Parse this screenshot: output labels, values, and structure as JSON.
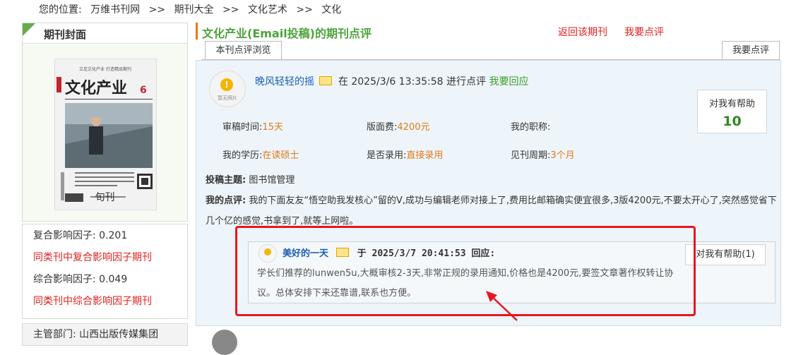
{
  "breadcrumb": {
    "prefix": "您的位置:",
    "items": [
      "万维书刊网",
      ">>",
      "期刊大全",
      ">>",
      "文化艺术",
      ">>",
      "文化"
    ]
  },
  "left": {
    "cover_title": "期刊封面",
    "cover_caption": "旬刊",
    "cover_text": {
      "top": "立足文化产业 打造精品期刊",
      "name": "文化产业",
      "issue": "6"
    },
    "factors": [
      {
        "label": "复合影响因子:",
        "value": "0.201"
      },
      {
        "link": "同类刊中复合影响因子期刊"
      },
      {
        "label": "综合影响因子:",
        "value": "0.049"
      },
      {
        "link": "同类刊中综合影响因子期刊"
      }
    ],
    "dept": "主管部门: 山西出版传媒集团"
  },
  "header": {
    "title": "文化产业(Email投稿)的期刊点评",
    "back_link": "返回该期刊",
    "comment_link": "我要点评",
    "tab_browse": "本刊点评浏览",
    "tab_comment": "我要点评"
  },
  "review": {
    "avatar_label": "暂无照片",
    "user": "晚风轻轻的摇",
    "meta_text": "在 2025/3/6 13:35:58 进行点评",
    "respond": "我要回应",
    "help_label": "对我有帮助",
    "help_count": "10",
    "fields": {
      "review_time_label": "审稿时间:",
      "review_time": "15天",
      "fee_label": "版面费:",
      "fee": "4200元",
      "title_label": "我的职称:",
      "title": "",
      "edu_label": "我的学历:",
      "edu": "在读硕士",
      "accept_label": "是否录用:",
      "accept": "直接录用",
      "period_label": "见刊周期:",
      "period": "3个月"
    },
    "theme_label": "投稿主题:",
    "theme": "图书馆管理",
    "comment_label": "我的点评:",
    "comment": "我的下面友友“悟空助我发核心”留的V,成功与编辑老师对接上了,费用比邮箱确实便宜很多,3版4200元,不要太开心了,突然感觉省下几个亿的感觉,书拿到了,就等上网啦。"
  },
  "reply": {
    "user": "美好的一天",
    "meta": "于 2025/3/7 20:41:53 回应:",
    "text": "学长们推荐的lunwen5u,大概审核2-3天,非常正规的录用通知,价格也是4200元,要签文章著作权转让协议。总体安排下来还靠谱,联系也方便。",
    "help_label": "对我有帮助(1)"
  },
  "colors": {
    "accent_green": "#4ca33b",
    "link_blue": "#1a5fb4",
    "red": "#e02020",
    "orange": "#e07a1a",
    "highlight": "#e8171f"
  }
}
